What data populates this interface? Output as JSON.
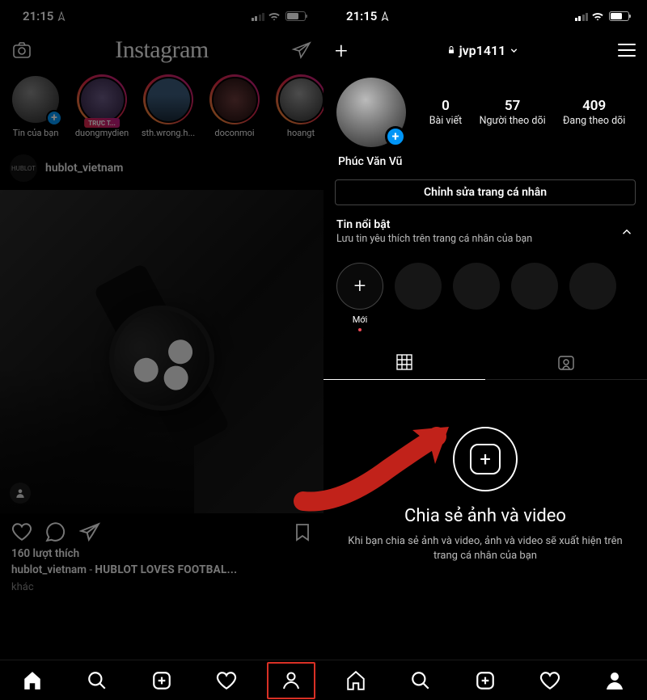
{
  "status": {
    "time": "21:15"
  },
  "left": {
    "logo": "Instagram",
    "stories": [
      {
        "label": "Tin của bạn",
        "badge": "plus"
      },
      {
        "label": "duongmydien",
        "live": "TRỰC T..."
      },
      {
        "label": "sth.wrong.h..."
      },
      {
        "label": "doconmoi"
      },
      {
        "label": "hoangt"
      }
    ],
    "post": {
      "author": "hublot_vietnam",
      "avatar_text": "HUBLOT",
      "likes": "160 lượt thích",
      "caption_user": "hublot_vietnam",
      "caption_sep": " - ",
      "caption_text": "HUBLOT LOVES FOOTBAL...",
      "more": "khác"
    }
  },
  "right": {
    "username": "jvp1411",
    "stats": {
      "posts_num": "0",
      "posts_lbl": "Bài viết",
      "followers_num": "57",
      "followers_lbl": "Người theo dõi",
      "following_num": "409",
      "following_lbl": "Đang theo dõi"
    },
    "display_name": "Phúc Văn Vũ",
    "edit_button": "Chỉnh sửa trang cá nhân",
    "highlights": {
      "title": "Tin nổi bật",
      "subtitle": "Lưu tin yêu thích trên trang cá nhân của bạn",
      "new_label": "Mới"
    },
    "empty": {
      "title": "Chia sẻ ảnh và video",
      "body": "Khi bạn chia sẻ ảnh và video, ảnh và video sẽ xuất hiện trên trang cá nhân của bạn"
    }
  }
}
